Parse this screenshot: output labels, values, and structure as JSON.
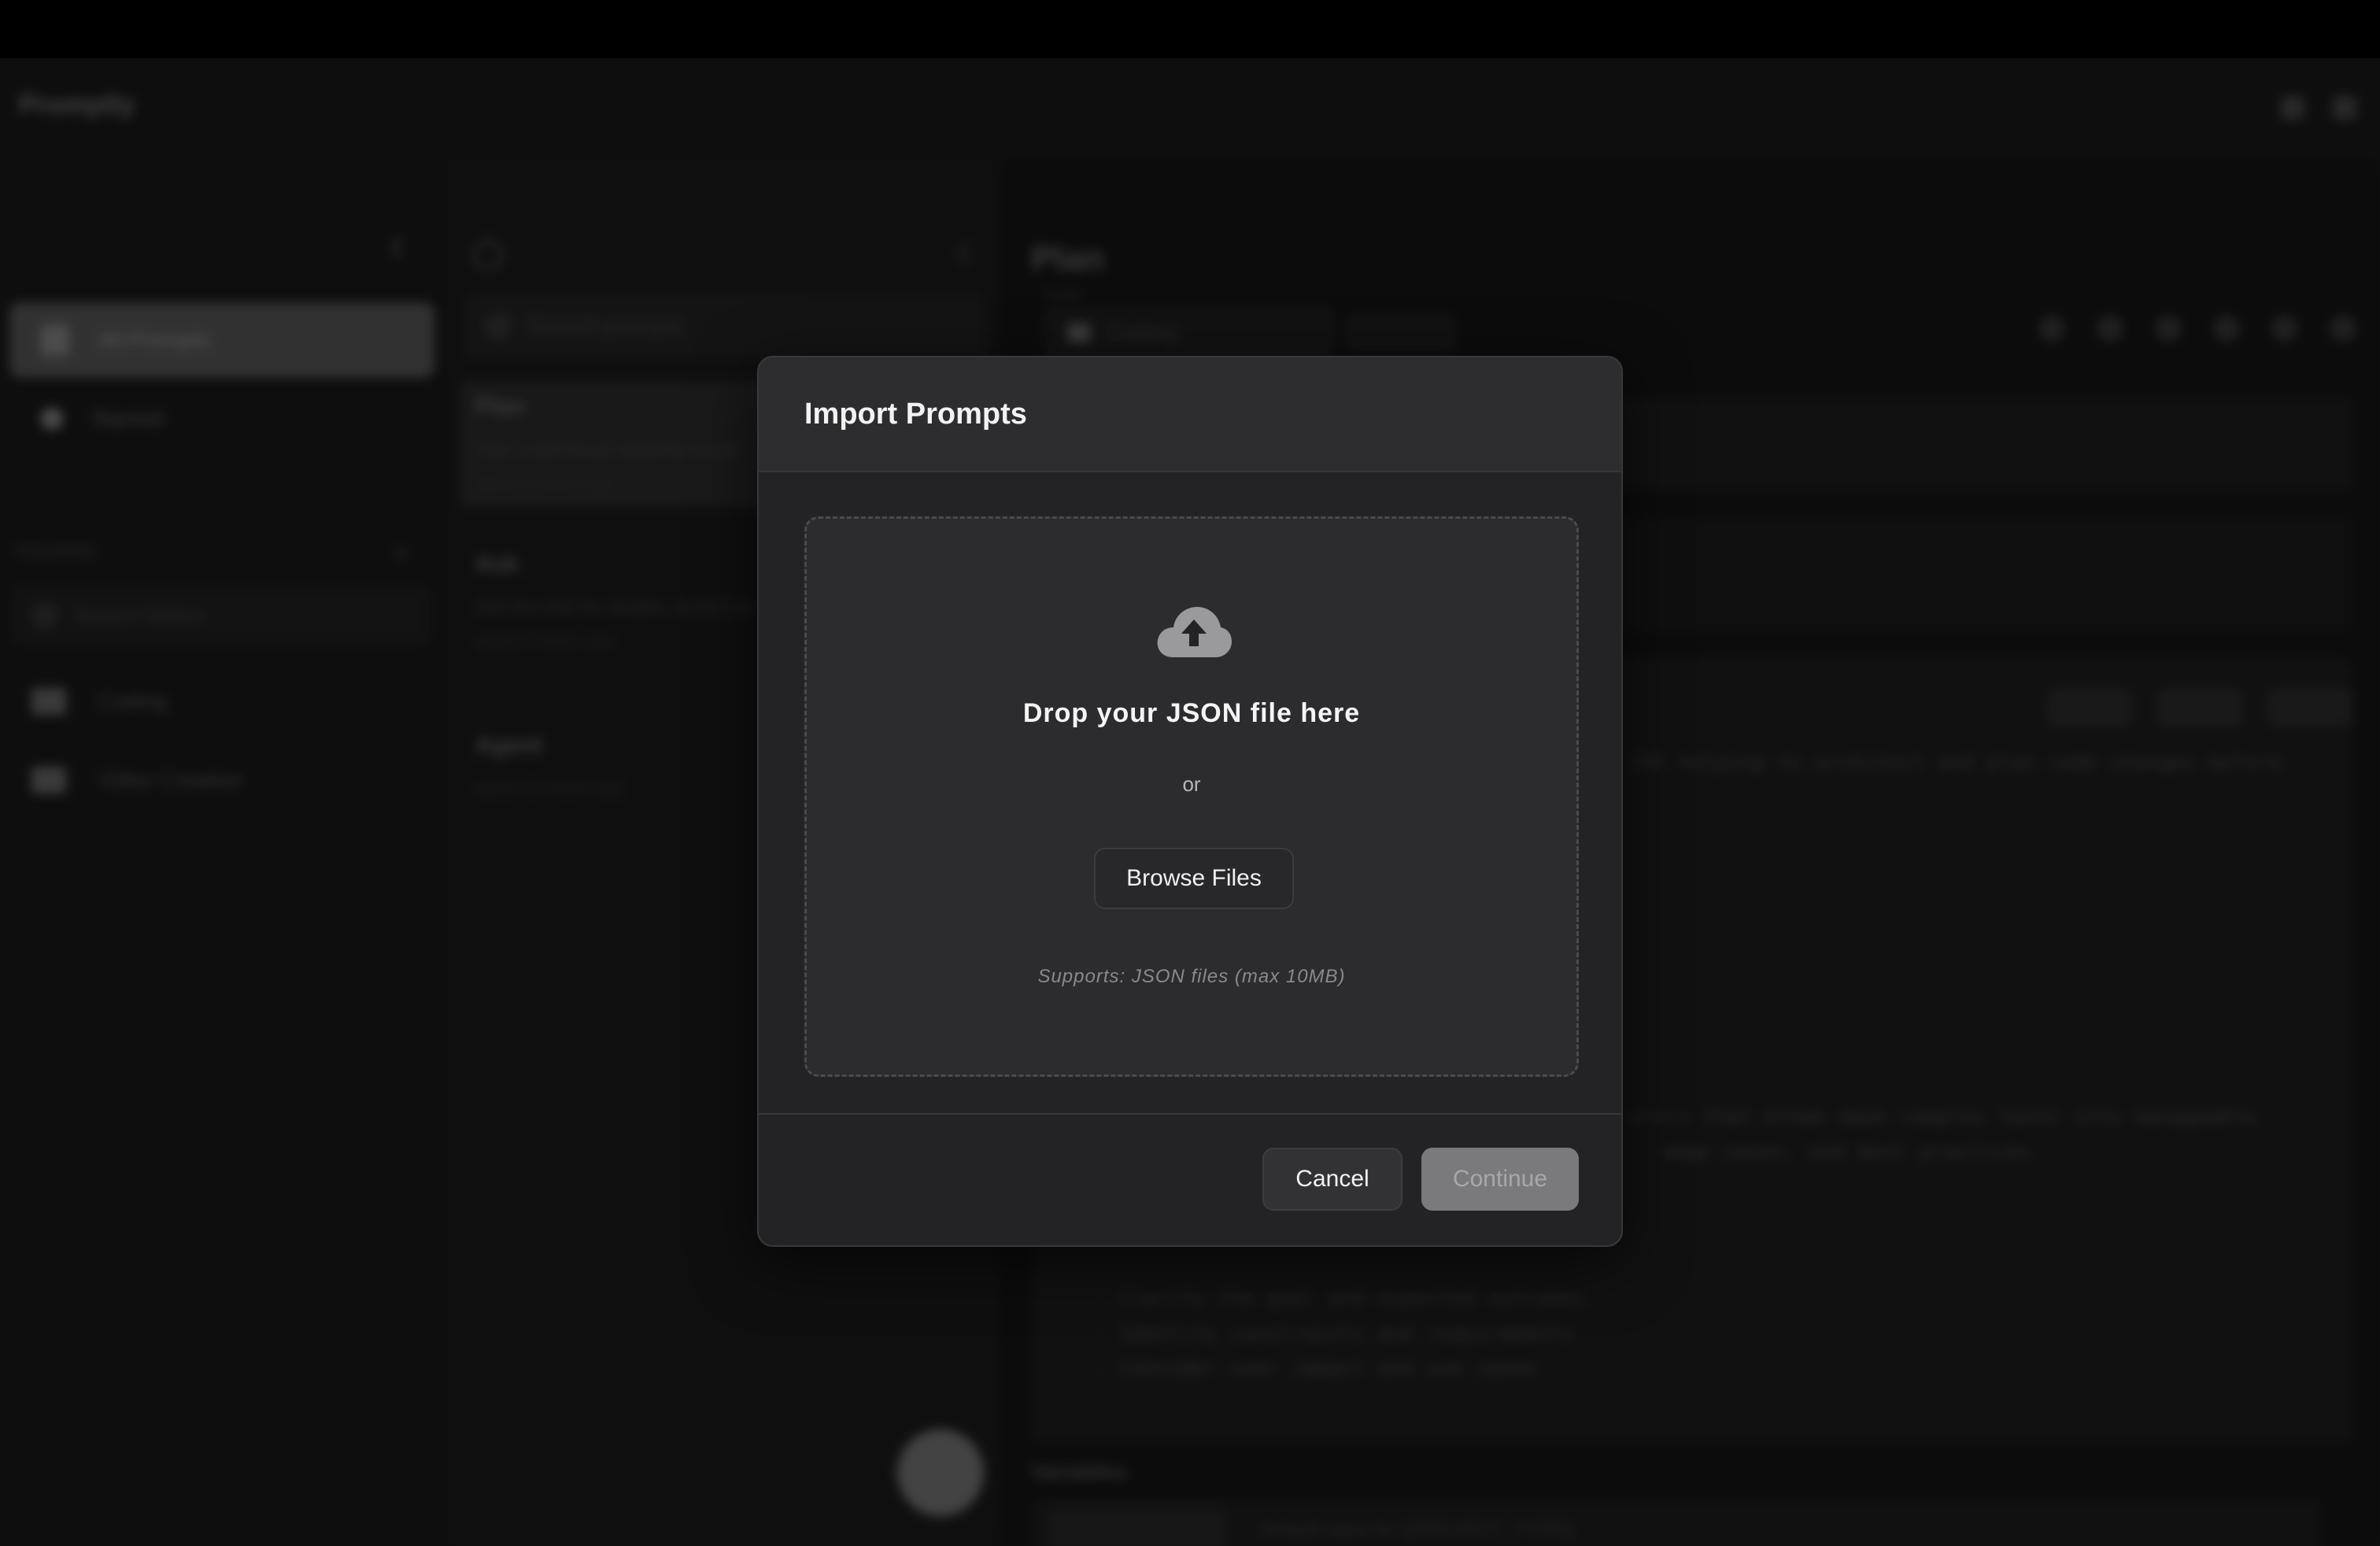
{
  "app": {
    "title": "Promptly"
  },
  "sidebar": {
    "items": [
      {
        "label": "All Prompts"
      },
      {
        "label": "Starred"
      }
    ],
    "section_label": "FOLDERS",
    "search_placeholder": "Search folders",
    "folders": [
      {
        "label": "Coding"
      },
      {
        "label": "Video Creation"
      }
    ]
  },
  "list": {
    "search_placeholder": "Search prompts",
    "prompts": [
      {
        "title": "Plan",
        "desc": "Plan a technical implementation",
        "meta": "about 8 hours ago"
      },
      {
        "title": "Ask",
        "desc": "Ask the IDE for doubts, technical",
        "meta": "about 8 hours ago"
      },
      {
        "title": "Agent",
        "desc": "",
        "meta": "about 21 hours ago"
      }
    ]
  },
  "editor": {
    "title": "Plan",
    "folder_label": "Folder",
    "folder_value": "Coding",
    "code_lines": [
      "IDE helping to architect and plan code changes before",
      "ators that break down complex tasks into manageable",
      "edge cases, and best practices.",
      "- Clarify the goal and expected outcomes",
      "- Identify constraints and requirements",
      "- Consider user impact and use cases"
    ],
    "variables_label": "Variables",
    "variables_placeholder": "Default value for {{PROJECT_TYPE}}"
  },
  "modal": {
    "title": "Import Prompts",
    "drop_text": "Drop your JSON file here",
    "or_text": "or",
    "browse_label": "Browse Files",
    "supports_text": "Supports: JSON files (max 10MB)",
    "cancel_label": "Cancel",
    "continue_label": "Continue",
    "continue_enabled": false
  },
  "colors": {
    "modal_bg": "#232325",
    "header_bg": "#2d2d30",
    "dropzone_bg": "#2c2c2f",
    "continue_disabled": "#7a7a7c"
  },
  "icons": [
    "cloud-upload-icon"
  ]
}
